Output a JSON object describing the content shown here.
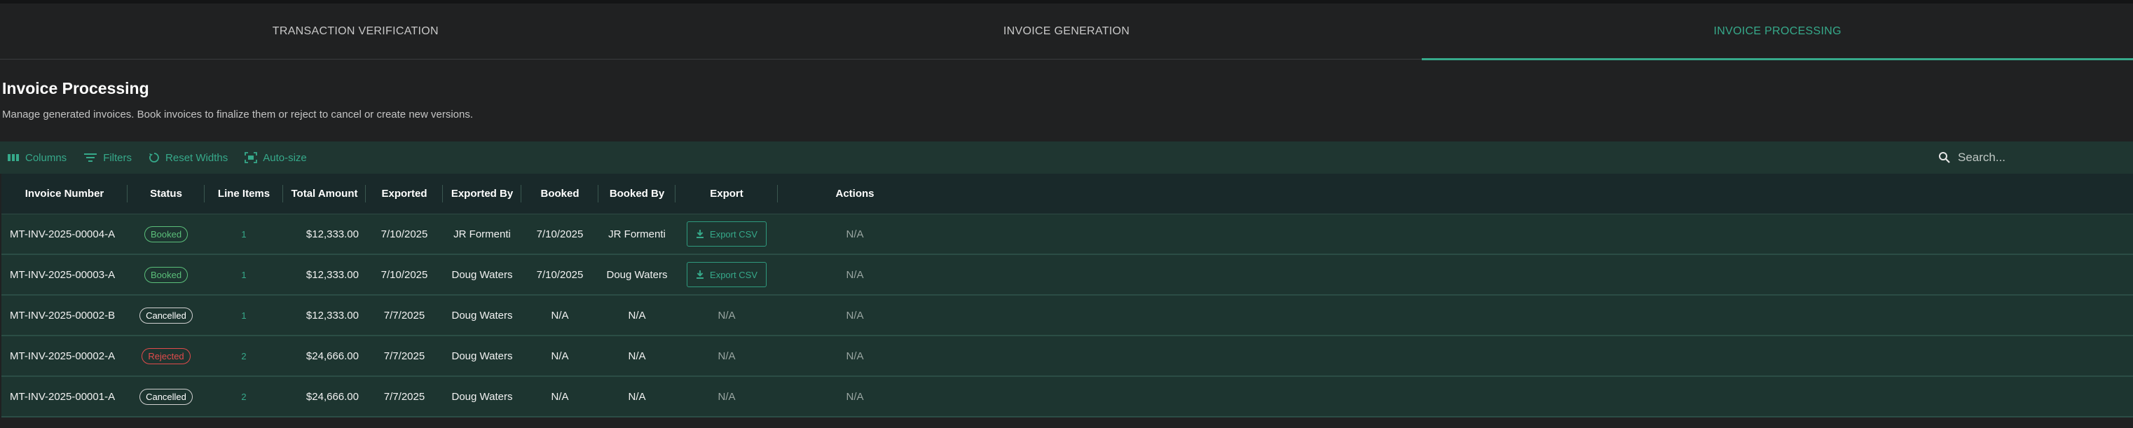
{
  "tabs": [
    {
      "label": "TRANSACTION VERIFICATION",
      "active": false
    },
    {
      "label": "INVOICE GENERATION",
      "active": false
    },
    {
      "label": "INVOICE PROCESSING",
      "active": true
    }
  ],
  "page": {
    "title": "Invoice Processing",
    "subtitle": "Manage generated invoices. Book invoices to finalize them or reject to cancel or create new versions."
  },
  "toolbar": {
    "columns_label": "Columns",
    "filters_label": "Filters",
    "reset_widths_label": "Reset Widths",
    "autosize_label": "Auto-size",
    "search_placeholder": "Search..."
  },
  "table": {
    "headers": {
      "invoice_number": "Invoice Number",
      "status": "Status",
      "line_items": "Line Items",
      "total_amount": "Total Amount",
      "exported": "Exported",
      "exported_by": "Exported By",
      "booked": "Booked",
      "booked_by": "Booked By",
      "export": "Export",
      "actions": "Actions"
    },
    "rows": [
      {
        "invoice_number": "MT-INV-2025-00004-A",
        "status": "Booked",
        "line_items": "1",
        "total_amount": "$12,333.00",
        "exported": "7/10/2025",
        "exported_by": "JR Formenti",
        "booked": "7/10/2025",
        "booked_by": "JR Formenti",
        "export": "Export CSV",
        "actions": "N/A"
      },
      {
        "invoice_number": "MT-INV-2025-00003-A",
        "status": "Booked",
        "line_items": "1",
        "total_amount": "$12,333.00",
        "exported": "7/10/2025",
        "exported_by": "Doug Waters",
        "booked": "7/10/2025",
        "booked_by": "Doug Waters",
        "export": "Export CSV",
        "actions": "N/A"
      },
      {
        "invoice_number": "MT-INV-2025-00002-B",
        "status": "Cancelled",
        "line_items": "1",
        "total_amount": "$12,333.00",
        "exported": "7/7/2025",
        "exported_by": "Doug Waters",
        "booked": "N/A",
        "booked_by": "N/A",
        "export": "N/A",
        "actions": "N/A"
      },
      {
        "invoice_number": "MT-INV-2025-00002-A",
        "status": "Rejected",
        "line_items": "2",
        "total_amount": "$24,666.00",
        "exported": "7/7/2025",
        "exported_by": "Doug Waters",
        "booked": "N/A",
        "booked_by": "N/A",
        "export": "N/A",
        "actions": "N/A"
      },
      {
        "invoice_number": "MT-INV-2025-00001-A",
        "status": "Cancelled",
        "line_items": "2",
        "total_amount": "$24,666.00",
        "exported": "7/7/2025",
        "exported_by": "Doug Waters",
        "booked": "N/A",
        "booked_by": "N/A",
        "export": "N/A",
        "actions": "N/A"
      }
    ]
  },
  "colors": {
    "accent": "#36a98a",
    "booked": "#5bbf7a",
    "rejected": "#e14b4b"
  },
  "icons": {
    "columns": "columns-icon",
    "filters": "filter-icon",
    "reset_widths": "reset-icon",
    "autosize": "autosize-icon",
    "search": "search-icon",
    "export": "download-icon"
  }
}
